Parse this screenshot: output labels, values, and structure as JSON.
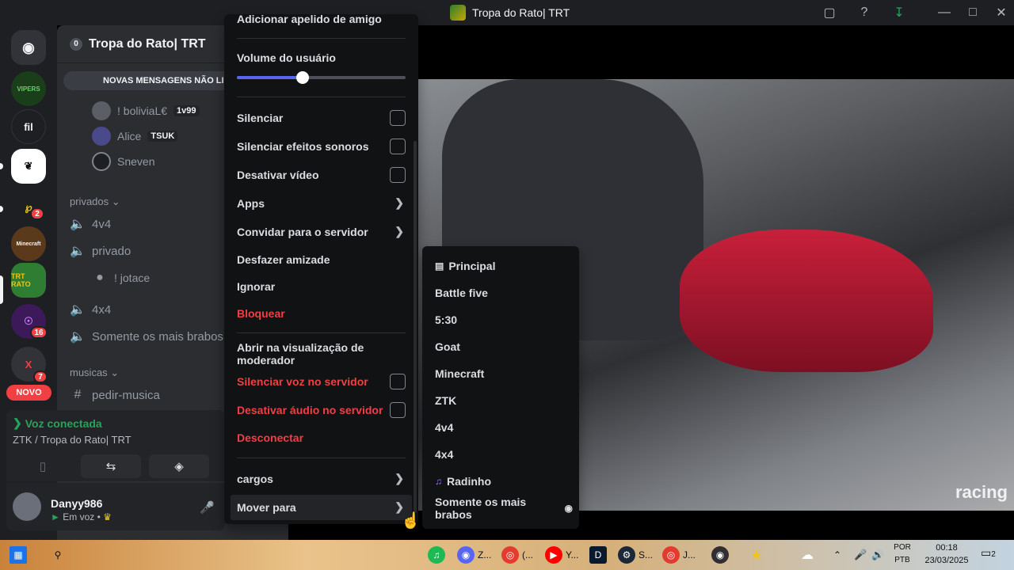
{
  "window": {
    "title": "Tropa do Rato| TRT"
  },
  "titlebar_icons": [
    "inbox-icon",
    "help-icon",
    "download-icon",
    "minimize-icon",
    "maximize-icon",
    "close-icon"
  ],
  "guilds": [
    {
      "name": "discord-home",
      "label": "",
      "badge": ""
    },
    {
      "name": "guild-vipers",
      "label": "VIPERS",
      "badge": ""
    },
    {
      "name": "guild-fil",
      "label": "fil",
      "badge": ""
    },
    {
      "name": "guild-current",
      "label": "",
      "badge": ""
    },
    {
      "name": "guild-n",
      "label": "",
      "badge": "2"
    },
    {
      "name": "guild-minecraft",
      "label": "Minecraft",
      "badge": ""
    },
    {
      "name": "guild-tropa-rato",
      "label": "TRT RATO",
      "badge": ""
    },
    {
      "name": "guild-purple",
      "label": "",
      "badge": "16"
    },
    {
      "name": "guild-x",
      "label": "X",
      "badge": "7"
    }
  ],
  "new_label": "NOVO",
  "server": {
    "name": "Tropa do Rato| TRT",
    "new_messages": "NOVAS MENSAGENS NÃO LI",
    "voice_users": [
      {
        "name": "! boliviaL€",
        "tag": "1v99"
      },
      {
        "name": "Alice",
        "tag": "TSUK"
      },
      {
        "name": "Sneven",
        "tag": ""
      }
    ],
    "categories": {
      "privados": "privados",
      "musicas": "musicas"
    },
    "channels": [
      {
        "label": "4v4",
        "icon": "speaker-icon"
      },
      {
        "label": "privado",
        "icon": "speaker-lock-icon"
      },
      {
        "label": "! jotace",
        "icon": "avatar"
      },
      {
        "label": "4x4",
        "icon": "speaker-icon"
      },
      {
        "label": "Somente os mais brabos",
        "icon": "speaker-lock-icon"
      },
      {
        "label": "pedir-musica",
        "icon": "hash-icon"
      }
    ]
  },
  "voice": {
    "status": "Voz conectada",
    "location": "ZTK / Tropa do Rato| TRT"
  },
  "user": {
    "name": "Danyy986",
    "status": "Em voz •"
  },
  "context_menu": {
    "top_item": "Adicionar apelido de amigo",
    "volume_label": "Volume do usuário",
    "volume_level": 0.39,
    "items": [
      {
        "label": "Silenciar",
        "kind": "checkbox"
      },
      {
        "label": "Silenciar efeitos sonoros",
        "kind": "checkbox"
      },
      {
        "label": "Desativar vídeo",
        "kind": "checkbox"
      },
      {
        "label": "Apps",
        "kind": "submenu"
      },
      {
        "label": "Convidar para o servidor",
        "kind": "submenu"
      },
      {
        "label": "Desfazer amizade",
        "kind": "plain"
      },
      {
        "label": "Ignorar",
        "kind": "plain"
      },
      {
        "label": "Bloquear",
        "kind": "danger"
      },
      {
        "label": "Abrir na visualização de moderador",
        "kind": "plain"
      },
      {
        "label": "Silenciar voz no servidor",
        "kind": "danger-checkbox"
      },
      {
        "label": "Desativar áudio no servidor",
        "kind": "danger-checkbox"
      },
      {
        "label": "Desconectar",
        "kind": "danger"
      },
      {
        "label": "cargos",
        "kind": "submenu"
      },
      {
        "label": "Mover para",
        "kind": "submenu"
      }
    ]
  },
  "move_submenu": [
    {
      "label": "Principal",
      "icon": "chat-icon"
    },
    {
      "label": "Battle five",
      "icon": ""
    },
    {
      "label": "5:30",
      "icon": ""
    },
    {
      "label": "Goat",
      "icon": ""
    },
    {
      "label": "Minecraft",
      "icon": ""
    },
    {
      "label": "ZTK",
      "icon": ""
    },
    {
      "label": "4v4",
      "icon": ""
    },
    {
      "label": "4x4",
      "icon": ""
    },
    {
      "label": "Radinho",
      "icon": "music-icon"
    },
    {
      "label": "Somente os mais brabos",
      "icon": "mouse-icon"
    }
  ],
  "video": {
    "watermark": "racing"
  },
  "taskbar": {
    "apps": [
      {
        "label": "",
        "color": "#1db954"
      },
      {
        "label": "Z...",
        "color": "#5865f2"
      },
      {
        "label": "(...",
        "color": "#e33b2e"
      },
      {
        "label": "Y...",
        "color": "#ff0000"
      },
      {
        "label": "",
        "color": "#0a1a2e"
      },
      {
        "label": "S...",
        "color": "#1b2838"
      },
      {
        "label": "J...",
        "color": "#e33b2e"
      },
      {
        "label": "",
        "color": "#302e31"
      },
      {
        "label": "",
        "color": "#f0c419"
      }
    ],
    "lang_top": "POR",
    "lang_bottom": "PTB",
    "time": "00:18",
    "date": "23/03/2025",
    "notifications": "2"
  }
}
